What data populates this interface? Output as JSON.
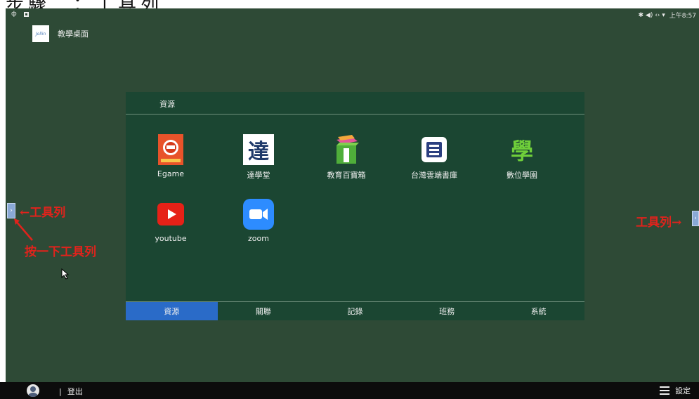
{
  "heading": {
    "text": "步驟二：工具列"
  },
  "status_bar": {
    "left_glyph": "ф",
    "right_icons": "✱ ◀) ‹› ▾",
    "time": "上午8:57"
  },
  "app": {
    "logo_text": "Jollin",
    "title": "教學桌面"
  },
  "panel": {
    "title": "資源",
    "apps": [
      {
        "label": "Egame",
        "icon": "egame-icon"
      },
      {
        "label": "達學堂",
        "icon": "da-xuetang-icon",
        "glyph": "達"
      },
      {
        "label": "教育百寶箱",
        "icon": "treasure-box-icon"
      },
      {
        "label": "台灣雲端書庫",
        "icon": "cloud-library-icon"
      },
      {
        "label": "數位學園",
        "icon": "digital-campus-icon",
        "glyph": "學"
      },
      {
        "label": "youtube",
        "icon": "youtube-icon"
      },
      {
        "label": "zoom",
        "icon": "zoom-icon"
      }
    ],
    "tabs": [
      {
        "label": "資源",
        "active": true
      },
      {
        "label": "關聯",
        "active": false
      },
      {
        "label": "記錄",
        "active": false
      },
      {
        "label": "班務",
        "active": false
      },
      {
        "label": "系統",
        "active": false
      }
    ]
  },
  "annotations": {
    "left_toolbar": "←工具列",
    "press_toolbar": "按一下工具列",
    "right_toolbar": "工具列→"
  },
  "handles": {
    "left": "›",
    "right": "‹"
  },
  "bottom_bar": {
    "logout_sep": "|",
    "logout": "登出",
    "settings": "設定"
  },
  "colors": {
    "desktop_bg": "#2e4a36",
    "panel_bg": "#1b4632",
    "active_tab": "#2a6bc8",
    "annotation_red": "#e0231c",
    "youtube_red": "#e62117",
    "zoom_blue": "#2d8cff"
  }
}
